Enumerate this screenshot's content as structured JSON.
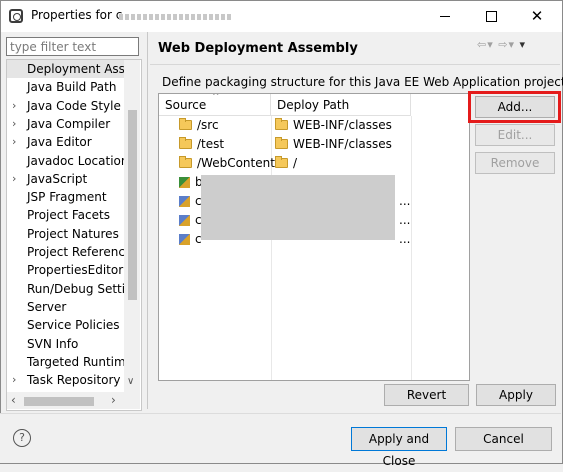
{
  "window": {
    "title": "Properties for c"
  },
  "sidebar": {
    "filter_placeholder": "type filter text",
    "items": [
      {
        "label": "Deployment Assembly",
        "expandable": false,
        "selected": true
      },
      {
        "label": "Java Build Path",
        "expandable": false
      },
      {
        "label": "Java Code Style",
        "expandable": true
      },
      {
        "label": "Java Compiler",
        "expandable": true
      },
      {
        "label": "Java Editor",
        "expandable": true
      },
      {
        "label": "Javadoc Location",
        "expandable": false
      },
      {
        "label": "JavaScript",
        "expandable": true
      },
      {
        "label": "JSP Fragment",
        "expandable": false
      },
      {
        "label": "Project Facets",
        "expandable": false
      },
      {
        "label": "Project Natures",
        "expandable": false
      },
      {
        "label": "Project References",
        "expandable": false
      },
      {
        "label": "PropertiesEditor",
        "expandable": false
      },
      {
        "label": "Run/Debug Settings",
        "expandable": false
      },
      {
        "label": "Server",
        "expandable": false
      },
      {
        "label": "Service Policies",
        "expandable": false
      },
      {
        "label": "SVN Info",
        "expandable": false
      },
      {
        "label": "Targeted Runtimes",
        "expandable": false
      },
      {
        "label": "Task Repository",
        "expandable": true
      }
    ]
  },
  "page": {
    "title": "Web Deployment Assembly",
    "description": "Define packaging structure for this Java EE Web Application project.",
    "table": {
      "columns": [
        "Source",
        "Deploy Path"
      ],
      "rows": [
        {
          "source": "/src",
          "deploy": "WEB-INF/classes"
        },
        {
          "source": "/test",
          "deploy": "WEB-INF/classes"
        },
        {
          "source": "/WebContent",
          "deploy": "/"
        }
      ],
      "extra_rows": [
        {
          "source": "b",
          "deploy": ""
        },
        {
          "source": "c",
          "deploy": "..."
        },
        {
          "source": "c",
          "deploy": "..."
        },
        {
          "source": "c",
          "deploy": "..."
        }
      ]
    },
    "buttons": {
      "add": "Add...",
      "edit": "Edit...",
      "remove": "Remove",
      "revert": "Revert",
      "apply": "Apply"
    }
  },
  "footer": {
    "help": "?",
    "apply_close": "Apply and Close",
    "cancel": "Cancel"
  },
  "colors": {
    "highlight": "#e41b1b",
    "default_button_border": "#0078d7"
  }
}
